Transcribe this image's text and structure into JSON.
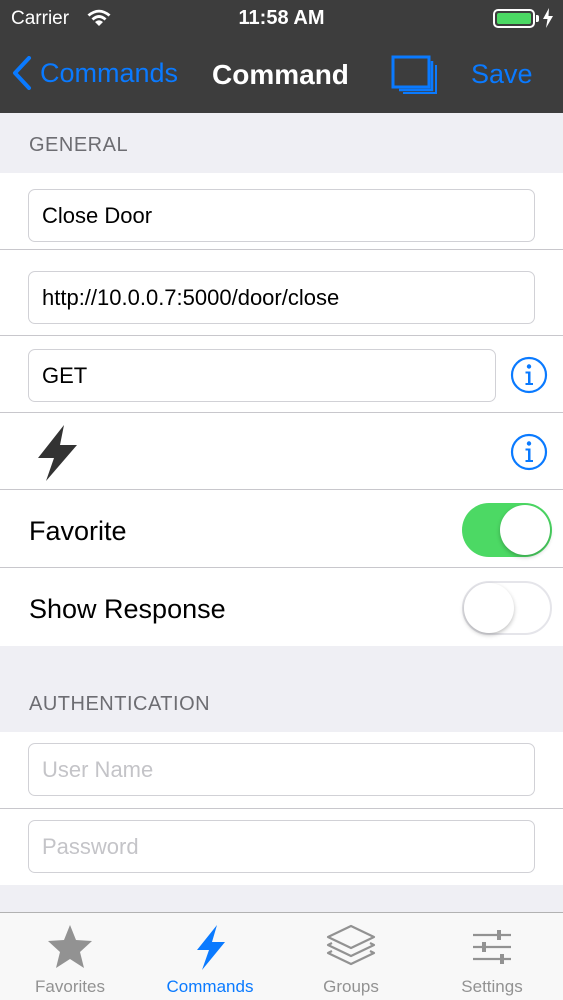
{
  "status_bar": {
    "carrier": "Carrier",
    "time": "11:58 AM",
    "battery_level": 1.0,
    "battery_color": "#4cd964"
  },
  "nav": {
    "back_label": "Commands",
    "title": "Command",
    "copy_icon": "duplicate-icon",
    "save_label": "Save",
    "accent": "#0a7aff"
  },
  "general": {
    "header": "GENERAL",
    "name_value": "Close Door",
    "url_value": "http://10.0.0.7:5000/door/close",
    "method_value": "GET",
    "icon": "lightning-bolt-icon",
    "favorite_label": "Favorite",
    "favorite_on": true,
    "show_response_label": "Show Response",
    "show_response_on": false
  },
  "authentication": {
    "header": "AUTHENTICATION",
    "username_placeholder": "User Name",
    "password_placeholder": "Password"
  },
  "tabs": [
    {
      "label": "Favorites",
      "icon": "star-icon",
      "active": false
    },
    {
      "label": "Commands",
      "icon": "lightning-bolt-icon",
      "active": true
    },
    {
      "label": "Groups",
      "icon": "stack-icon",
      "active": false
    },
    {
      "label": "Settings",
      "icon": "sliders-icon",
      "active": false
    }
  ]
}
